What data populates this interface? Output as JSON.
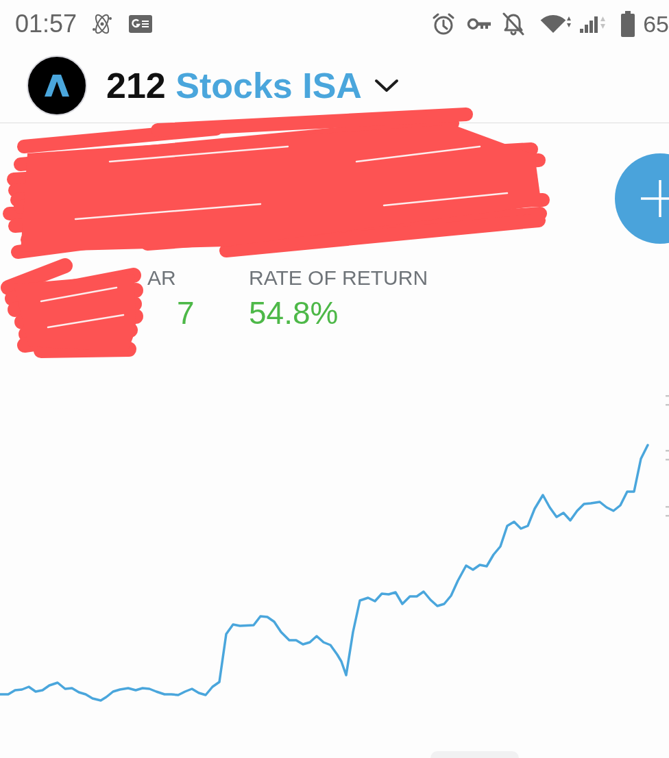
{
  "status_bar": {
    "time": "01:57",
    "battery": "65"
  },
  "header": {
    "account": {
      "number": "212",
      "name": "Stocks ISA",
      "expanded": false
    }
  },
  "stats": [
    {
      "label": "AR",
      "value": "7",
      "positive": true
    },
    {
      "label": "RATE OF RETURN",
      "value": "54.8%",
      "positive": true
    }
  ]
}
